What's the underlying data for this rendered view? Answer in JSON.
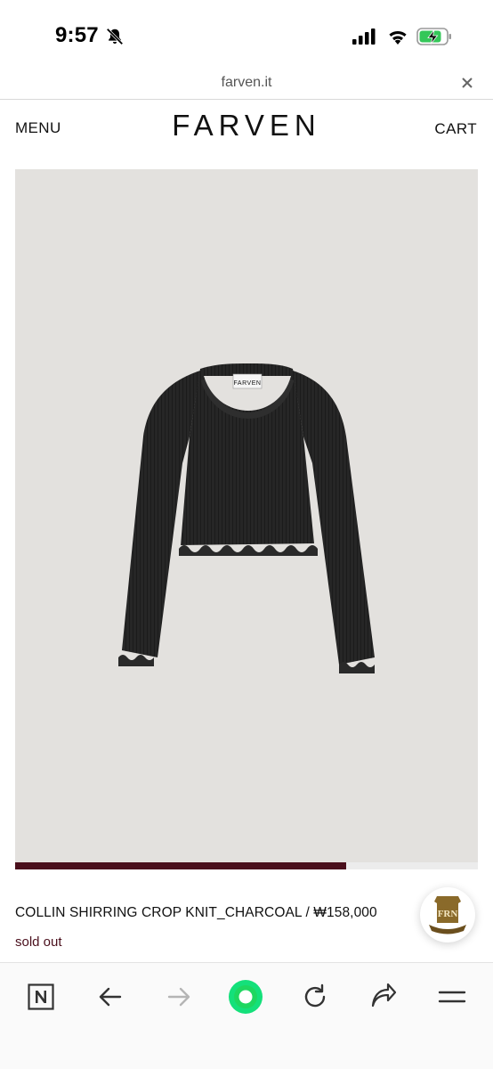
{
  "status_bar": {
    "time": "9:57",
    "icons": [
      "bell-slash-icon",
      "cellular-signal-icon",
      "wifi-icon",
      "battery-charging-icon"
    ],
    "battery_color": "#34c759"
  },
  "url_bar": {
    "domain": "farven.it",
    "close_icon": "close-icon"
  },
  "header": {
    "menu_label": "MENU",
    "logo": "FARVEN",
    "cart_label": "CART"
  },
  "product": {
    "image_alt_icon": "crop-knit-top-image",
    "slider_progress": 0.715,
    "name_price": "COLLIN SHIRRING CROP KNIT_CHARCOAL / ₩158,000",
    "stock_status": "sold out"
  },
  "badge": {
    "letters": "FRN",
    "ribbon": "FARVEN"
  },
  "toolbar": {
    "icons": [
      "naver-home-icon",
      "back-arrow-icon",
      "forward-arrow-icon",
      "green-dot-icon",
      "reload-icon",
      "share-icon",
      "menu-icon"
    ]
  },
  "colors": {
    "accent": "#4a0f1c",
    "image_bg": "#e3e1de",
    "green": "#1ed760"
  }
}
